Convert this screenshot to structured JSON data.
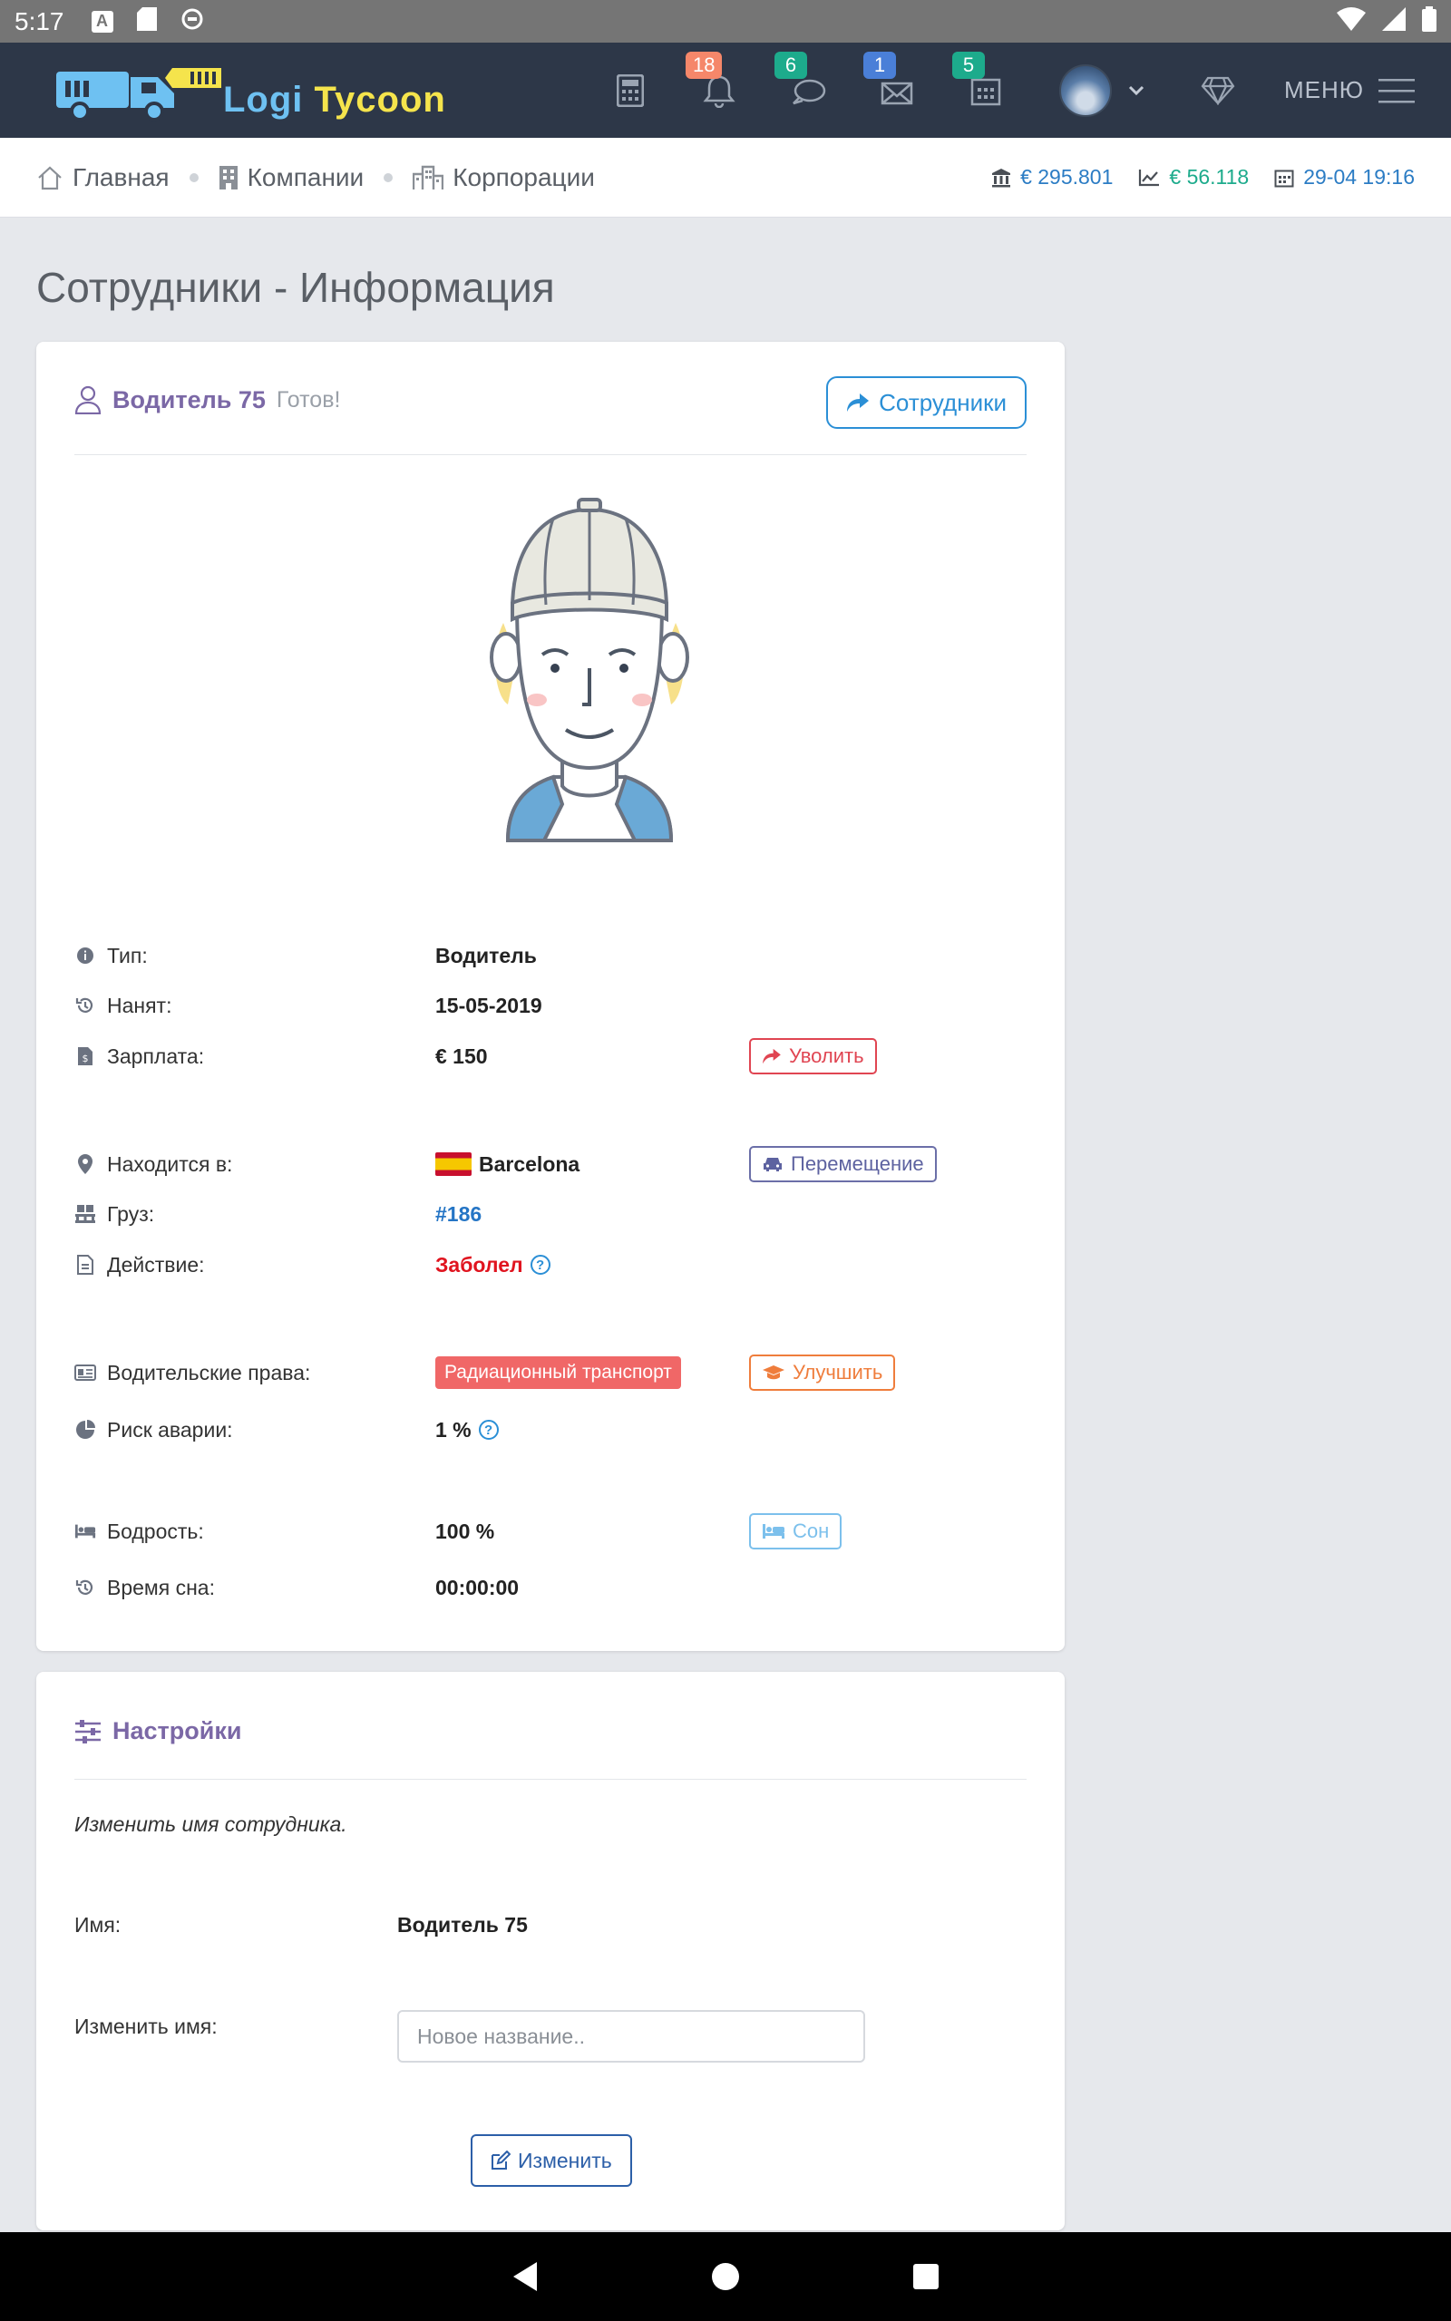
{
  "status_bar": {
    "time": "5:17",
    "icons": [
      "a-icon",
      "sd-card-icon",
      "cast-icon"
    ],
    "right_icons": [
      "wifi-icon",
      "signal-icon",
      "battery-icon"
    ]
  },
  "nav": {
    "logo_part1": "Logi",
    "logo_part2": "Tycoon",
    "badges": {
      "notifications": "18",
      "messages": "6",
      "mail": "1",
      "calendar": "5"
    },
    "badge_colors": {
      "notifications": "#f5876a",
      "messages": "#1dab8c",
      "mail": "#4a7fd8",
      "calendar": "#1dab8c"
    },
    "menu_label": "МЕНЮ"
  },
  "breadcrumb": [
    "Главная",
    "Компании",
    "Корпорации"
  ],
  "stats": {
    "money": "€ 295.801",
    "income": "€ 56.118",
    "datetime": "29-04 19:16"
  },
  "stats_colors": {
    "money": "#2b7cc4",
    "income": "#1dab8c",
    "datetime": "#2b7cc4"
  },
  "page_title": "Сотрудники - Информация",
  "employee": {
    "name": "Водитель 75",
    "status": "Готов!",
    "back_button": "Сотрудники",
    "rows": {
      "type": {
        "label": "Тип:",
        "value": "Водитель"
      },
      "hired": {
        "label": "Нанят:",
        "value": "15-05-2019"
      },
      "salary": {
        "label": "Зарплата:",
        "value": "€ 150",
        "action": "Уволить"
      },
      "location": {
        "label": "Находится в:",
        "value": "Barcelona",
        "action": "Перемещение"
      },
      "cargo": {
        "label": "Груз:",
        "value": "#186"
      },
      "activity": {
        "label": "Действие:",
        "value": "Заболел"
      },
      "license": {
        "label": "Водительские права:",
        "value": "Радиационный транспорт",
        "action": "Улучшить"
      },
      "risk": {
        "label": "Риск аварии:",
        "value": "1 %"
      },
      "energy": {
        "label": "Бодрость:",
        "value": "100 %",
        "action": "Сон"
      },
      "sleep_time": {
        "label": "Время сна:",
        "value": "00:00:00"
      }
    }
  },
  "settings": {
    "title": "Настройки",
    "hint": "Изменить имя сотрудника.",
    "name_label": "Имя:",
    "name_value": "Водитель 75",
    "rename_label": "Изменить имя:",
    "rename_placeholder": "Новое название..",
    "submit": "Изменить"
  }
}
